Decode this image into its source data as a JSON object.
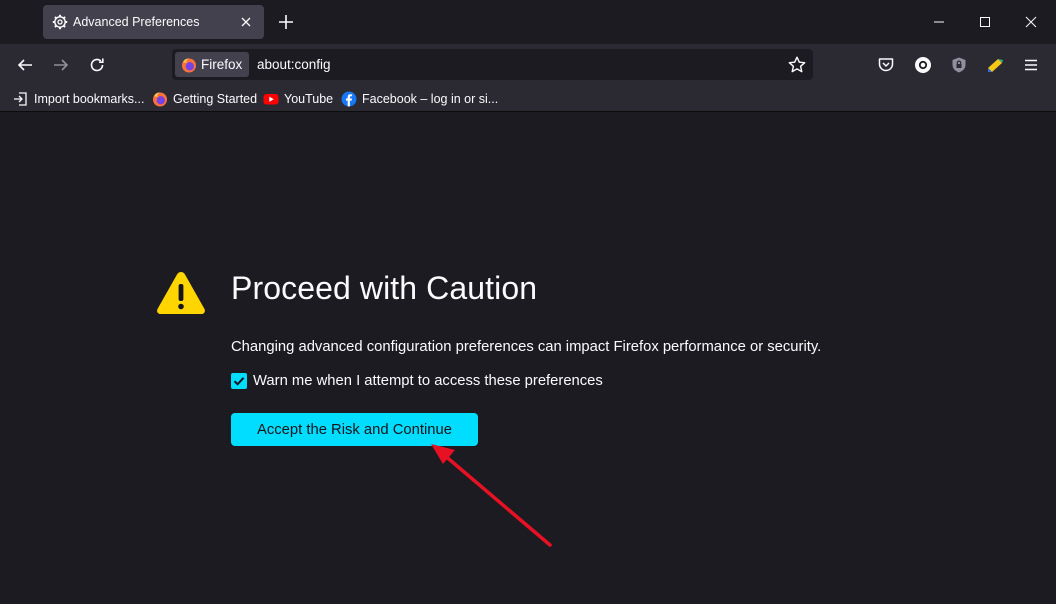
{
  "tab": {
    "title": "Advanced Preferences",
    "icon": "gear-icon"
  },
  "window_controls": [
    "minimize",
    "maximize",
    "close"
  ],
  "navbar": {
    "identity_label": "Firefox",
    "url": "about:config"
  },
  "bookmarks": [
    {
      "label": "Import bookmarks...",
      "icon": "import-icon"
    },
    {
      "label": "Getting Started",
      "icon": "firefox-logo-icon"
    },
    {
      "label": "YouTube",
      "icon": "youtube-icon"
    },
    {
      "label": "Facebook – log in or si...",
      "icon": "facebook-icon"
    }
  ],
  "content": {
    "heading": "Proceed with Caution",
    "description": "Changing advanced configuration preferences can impact Firefox performance or security.",
    "checkbox_label": "Warn me when I attempt to access these preferences",
    "checkbox_checked": true,
    "accept_button": "Accept the Risk and Continue"
  },
  "colors": {
    "accent": "#00ddff",
    "warning": "#ffd500",
    "annotation_arrow": "#e81123",
    "background": "#1c1b22",
    "toolbar": "#2b2a33"
  }
}
